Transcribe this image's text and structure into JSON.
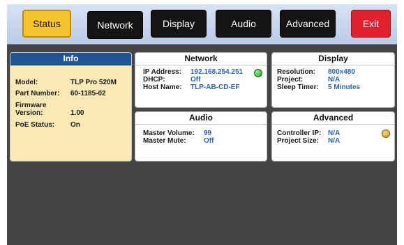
{
  "nav": {
    "tabs": [
      {
        "label": "Status",
        "state": "active"
      },
      {
        "label": "Network",
        "state": "normal"
      },
      {
        "label": "Display",
        "state": "normal"
      },
      {
        "label": "Audio",
        "state": "normal"
      },
      {
        "label": "Advanced",
        "state": "normal"
      },
      {
        "label": "Exit",
        "state": "exit"
      }
    ]
  },
  "info": {
    "title": "Info",
    "model_label": "Model:",
    "model_value": "TLP Pro 520M",
    "part_label": "Part Number:",
    "part_value": "60-1185-02",
    "fw_label_line1": "Firmware",
    "fw_label_line2": "Version:",
    "fw_value": "1.00",
    "poe_label": "PoE Status:",
    "poe_value": "On"
  },
  "network": {
    "title": "Network",
    "ip_label": "IP Address:",
    "ip_value": "192.168.254.251",
    "dhcp_label": "DHCP:",
    "dhcp_value": "Off",
    "host_label": "Host Name:",
    "host_value": "TLP-AB-CD-EF",
    "status_led": "green"
  },
  "display": {
    "title": "Display",
    "res_label": "Resolution:",
    "res_value": "800x480",
    "project_label": "Project:",
    "project_value": "N/A",
    "sleep_label": "Sleep Timer:",
    "sleep_value": "5 Minutes"
  },
  "audio": {
    "title": "Audio",
    "vol_label": "Master Volume:",
    "vol_value": "99",
    "mute_label": "Master Mute:",
    "mute_value": "Off"
  },
  "advanced": {
    "title": "Advanced",
    "ctrl_label": "Controller IP:",
    "ctrl_value": "N/A",
    "size_label": "Project Size:",
    "size_value": "N/A",
    "status_led": "amber"
  },
  "colors": {
    "active_tab": "#f6c42c",
    "exit_tab": "#e0202a",
    "value_text": "#2a66b4",
    "info_header": "#1f5595",
    "info_bg": "#fbe9b5",
    "background": "#454545"
  }
}
